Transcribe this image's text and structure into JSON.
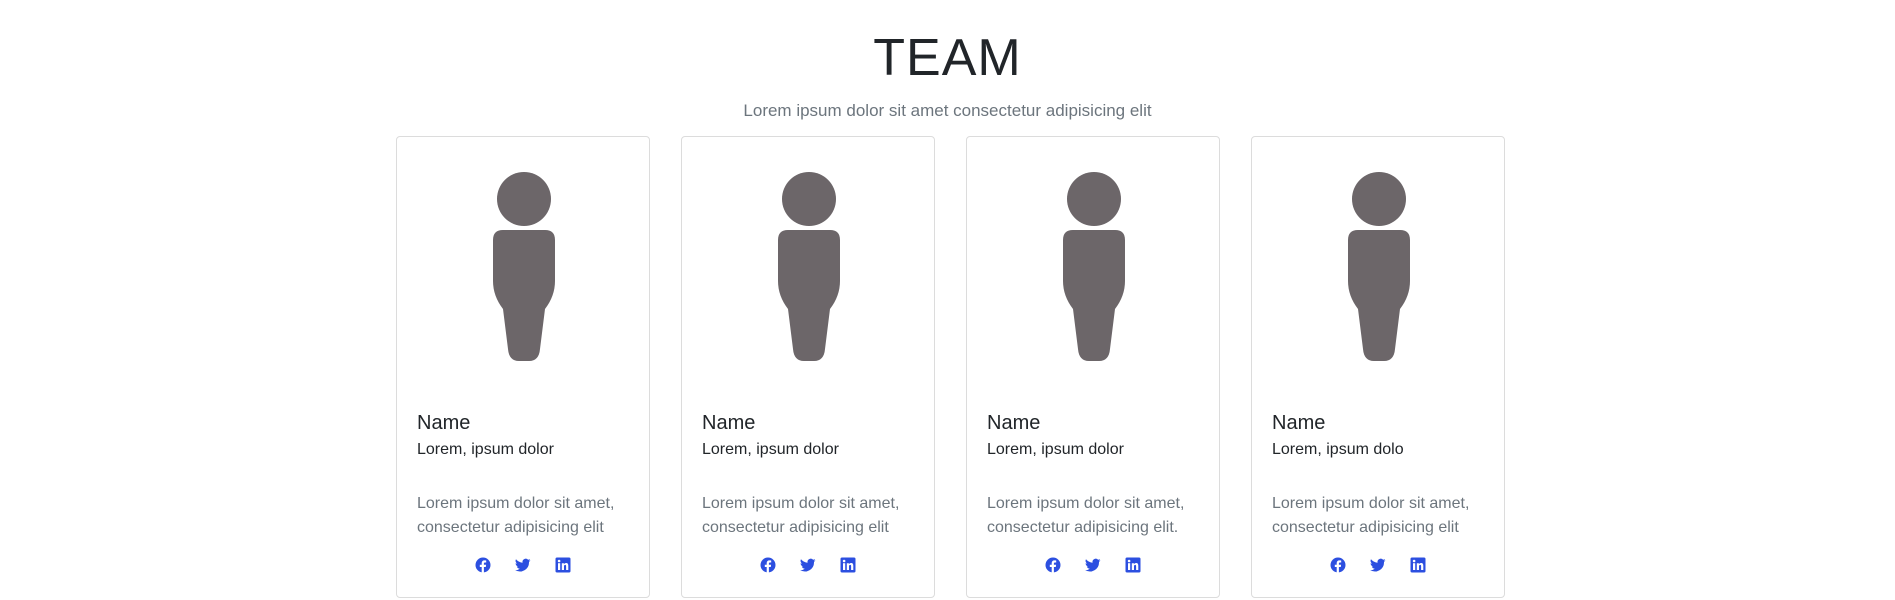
{
  "header": {
    "title": "TEAM",
    "subtitle": "Lorem ipsum dolor sit amet consectetur adipisicing elit"
  },
  "colors": {
    "accent": "#2c4fe0",
    "avatar": "#6c6669",
    "border": "#dcdcdc"
  },
  "members": [
    {
      "name": "Name",
      "role": "Lorem, ipsum dolor",
      "desc": "Lorem ipsum dolor sit amet, consectetur adipisicing elit",
      "icons": [
        "facebook-icon",
        "twitter-icon",
        "linkedin-icon"
      ]
    },
    {
      "name": "Name",
      "role": "Lorem, ipsum dolor",
      "desc": "Lorem ipsum dolor sit amet, consectetur adipisicing elit",
      "icons": [
        "facebook-icon",
        "twitter-icon",
        "linkedin-icon"
      ]
    },
    {
      "name": "Name",
      "role": "Lorem, ipsum dolor",
      "desc": "Lorem ipsum dolor sit amet, consectetur adipisicing elit.",
      "icons": [
        "facebook-icon",
        "twitter-icon",
        "linkedin-icon"
      ]
    },
    {
      "name": "Name",
      "role": "Lorem, ipsum dolo",
      "desc": "Lorem ipsum dolor sit amet, consectetur adipisicing elit",
      "icons": [
        "facebook-icon",
        "twitter-icon",
        "linkedin-icon"
      ]
    }
  ]
}
